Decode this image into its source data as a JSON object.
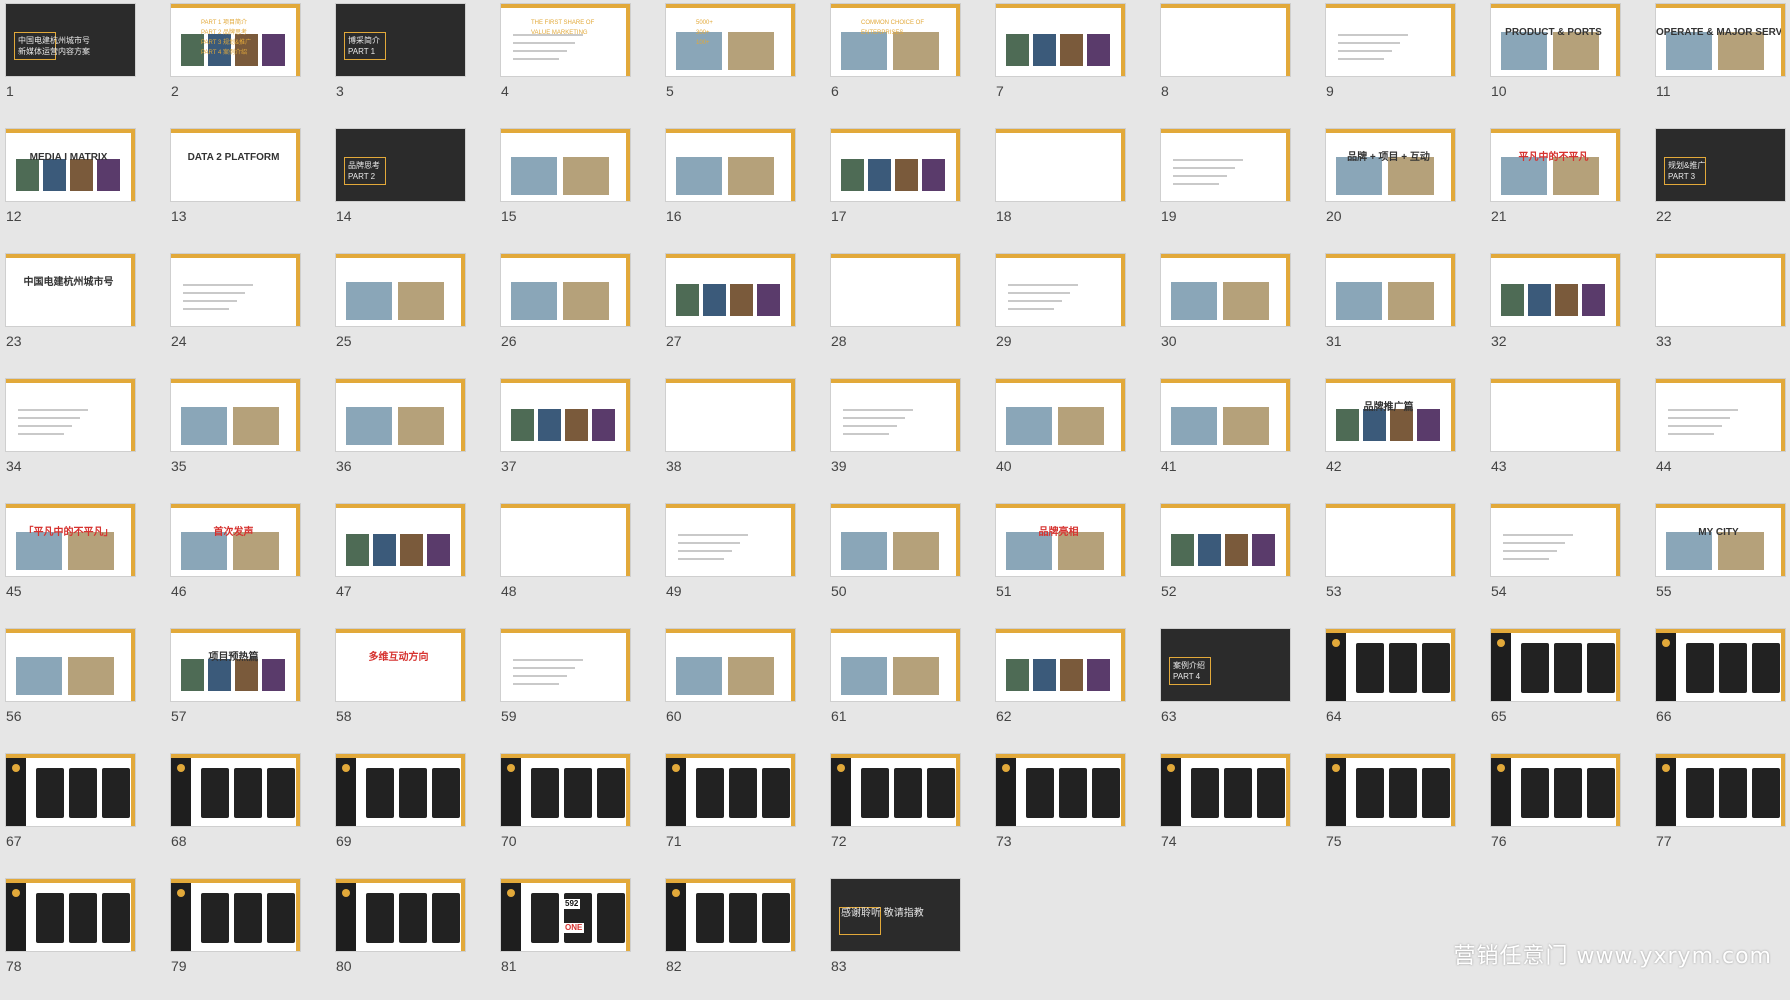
{
  "app": {
    "view": "slide-sorter",
    "watermark": "营销任意门 www.yxrym.com"
  },
  "colors": {
    "accent": "#e2a93a",
    "red": "#d6322f",
    "dark": "#2b2b2b",
    "background": "#e6e6e6"
  },
  "slides": [
    {
      "num": "1",
      "style": "dark",
      "lines": [
        "中国电建杭州城市号",
        "新媒体运营内容方案"
      ]
    },
    {
      "num": "2",
      "style": "white",
      "lines": [
        "PART 1  项目简介",
        "PART 2  品牌思考",
        "PART 3  规划&推广",
        "PART 4  案例介绍"
      ]
    },
    {
      "num": "3",
      "style": "dark",
      "lines": [
        "博采简介",
        "PART 1"
      ]
    },
    {
      "num": "4",
      "style": "white",
      "lines": [
        "THE FIRST SHARE OF",
        "VALUE MARKETING"
      ]
    },
    {
      "num": "5",
      "style": "white",
      "lines": [
        "5000+",
        "300+",
        "100+"
      ]
    },
    {
      "num": "6",
      "style": "white",
      "lines": [
        "COMMON CHOICE OF",
        "ENTERPRISES"
      ]
    },
    {
      "num": "7",
      "style": "white",
      "lines": []
    },
    {
      "num": "8",
      "style": "white",
      "lines": []
    },
    {
      "num": "9",
      "style": "white",
      "lines": []
    },
    {
      "num": "10",
      "style": "white",
      "lines": [
        "PRODUCT & PORTS"
      ]
    },
    {
      "num": "11",
      "style": "white",
      "lines": [
        "OPERATE & MAJOR SERVICES"
      ]
    },
    {
      "num": "12",
      "style": "white",
      "lines": [
        "MEDIA I MATRIX"
      ]
    },
    {
      "num": "13",
      "style": "white",
      "lines": [
        "DATA 2 PLATFORM"
      ]
    },
    {
      "num": "14",
      "style": "dark",
      "lines": [
        "品牌思考",
        "PART 2"
      ]
    },
    {
      "num": "15",
      "style": "white",
      "lines": []
    },
    {
      "num": "16",
      "style": "white",
      "lines": []
    },
    {
      "num": "17",
      "style": "white",
      "lines": []
    },
    {
      "num": "18",
      "style": "white",
      "lines": []
    },
    {
      "num": "19",
      "style": "white",
      "lines": []
    },
    {
      "num": "20",
      "style": "white",
      "lines": [
        "品牌 + 项目 + 互动"
      ]
    },
    {
      "num": "21",
      "style": "white",
      "lines": [
        "平凡中的不平凡"
      ]
    },
    {
      "num": "22",
      "style": "dark",
      "lines": [
        "规划&推广",
        "PART 3"
      ]
    },
    {
      "num": "23",
      "style": "white",
      "lines": [
        "中国电建杭州城市号"
      ]
    },
    {
      "num": "24",
      "style": "white",
      "lines": []
    },
    {
      "num": "25",
      "style": "white",
      "lines": []
    },
    {
      "num": "26",
      "style": "white",
      "lines": []
    },
    {
      "num": "27",
      "style": "white",
      "lines": []
    },
    {
      "num": "28",
      "style": "white",
      "lines": []
    },
    {
      "num": "29",
      "style": "white",
      "lines": []
    },
    {
      "num": "30",
      "style": "white",
      "lines": []
    },
    {
      "num": "31",
      "style": "white",
      "lines": []
    },
    {
      "num": "32",
      "style": "white",
      "lines": []
    },
    {
      "num": "33",
      "style": "white",
      "lines": []
    },
    {
      "num": "34",
      "style": "white",
      "lines": []
    },
    {
      "num": "35",
      "style": "white",
      "lines": []
    },
    {
      "num": "36",
      "style": "white",
      "lines": []
    },
    {
      "num": "37",
      "style": "white",
      "lines": []
    },
    {
      "num": "38",
      "style": "white",
      "lines": []
    },
    {
      "num": "39",
      "style": "white",
      "lines": []
    },
    {
      "num": "40",
      "style": "white",
      "lines": []
    },
    {
      "num": "41",
      "style": "white",
      "lines": []
    },
    {
      "num": "42",
      "style": "white",
      "lines": [
        "品牌推广篇"
      ]
    },
    {
      "num": "43",
      "style": "white",
      "lines": []
    },
    {
      "num": "44",
      "style": "white",
      "lines": []
    },
    {
      "num": "45",
      "style": "white",
      "lines": [
        "「平凡中的不平凡」"
      ]
    },
    {
      "num": "46",
      "style": "white",
      "lines": [
        "首次发声"
      ]
    },
    {
      "num": "47",
      "style": "white",
      "lines": []
    },
    {
      "num": "48",
      "style": "white",
      "lines": []
    },
    {
      "num": "49",
      "style": "white",
      "lines": []
    },
    {
      "num": "50",
      "style": "white",
      "lines": []
    },
    {
      "num": "51",
      "style": "white",
      "lines": [
        "品牌亮相"
      ]
    },
    {
      "num": "52",
      "style": "white",
      "lines": []
    },
    {
      "num": "53",
      "style": "white",
      "lines": []
    },
    {
      "num": "54",
      "style": "white",
      "lines": []
    },
    {
      "num": "55",
      "style": "white",
      "lines": [
        "MY CITY"
      ]
    },
    {
      "num": "56",
      "style": "white",
      "lines": []
    },
    {
      "num": "57",
      "style": "white",
      "lines": [
        "项目预热篇"
      ]
    },
    {
      "num": "58",
      "style": "white",
      "lines": [
        "多维互动方向"
      ]
    },
    {
      "num": "59",
      "style": "white",
      "lines": []
    },
    {
      "num": "60",
      "style": "white",
      "lines": []
    },
    {
      "num": "61",
      "style": "white",
      "lines": []
    },
    {
      "num": "62",
      "style": "white",
      "lines": []
    },
    {
      "num": "63",
      "style": "dark",
      "lines": [
        "案例介绍",
        "PART 4"
      ]
    },
    {
      "num": "64",
      "style": "case",
      "lines": []
    },
    {
      "num": "65",
      "style": "case",
      "lines": []
    },
    {
      "num": "66",
      "style": "case",
      "lines": []
    },
    {
      "num": "67",
      "style": "case",
      "lines": []
    },
    {
      "num": "68",
      "style": "case",
      "lines": []
    },
    {
      "num": "69",
      "style": "case",
      "lines": []
    },
    {
      "num": "70",
      "style": "case",
      "lines": []
    },
    {
      "num": "71",
      "style": "case",
      "lines": []
    },
    {
      "num": "72",
      "style": "case",
      "lines": []
    },
    {
      "num": "73",
      "style": "case",
      "lines": []
    },
    {
      "num": "74",
      "style": "case",
      "lines": []
    },
    {
      "num": "75",
      "style": "case",
      "lines": []
    },
    {
      "num": "76",
      "style": "case",
      "lines": []
    },
    {
      "num": "77",
      "style": "case",
      "lines": []
    },
    {
      "num": "78",
      "style": "case",
      "lines": []
    },
    {
      "num": "79",
      "style": "case",
      "lines": []
    },
    {
      "num": "80",
      "style": "case",
      "lines": []
    },
    {
      "num": "81",
      "style": "case",
      "lines": [
        "592",
        "ONE"
      ]
    },
    {
      "num": "82",
      "style": "case",
      "lines": []
    },
    {
      "num": "83",
      "style": "dark",
      "lines": [
        "感谢聆听  敬请指教"
      ]
    }
  ]
}
